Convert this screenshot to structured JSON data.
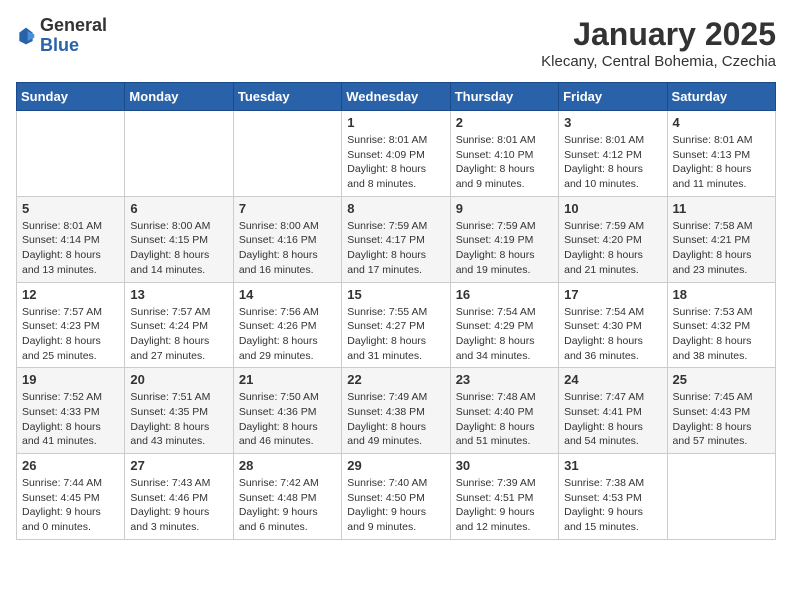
{
  "header": {
    "logo_general": "General",
    "logo_blue": "Blue",
    "month_title": "January 2025",
    "location": "Klecany, Central Bohemia, Czechia"
  },
  "weekdays": [
    "Sunday",
    "Monday",
    "Tuesday",
    "Wednesday",
    "Thursday",
    "Friday",
    "Saturday"
  ],
  "weeks": [
    [
      {
        "day": "",
        "content": ""
      },
      {
        "day": "",
        "content": ""
      },
      {
        "day": "",
        "content": ""
      },
      {
        "day": "1",
        "content": "Sunrise: 8:01 AM\nSunset: 4:09 PM\nDaylight: 8 hours and 8 minutes."
      },
      {
        "day": "2",
        "content": "Sunrise: 8:01 AM\nSunset: 4:10 PM\nDaylight: 8 hours and 9 minutes."
      },
      {
        "day": "3",
        "content": "Sunrise: 8:01 AM\nSunset: 4:12 PM\nDaylight: 8 hours and 10 minutes."
      },
      {
        "day": "4",
        "content": "Sunrise: 8:01 AM\nSunset: 4:13 PM\nDaylight: 8 hours and 11 minutes."
      }
    ],
    [
      {
        "day": "5",
        "content": "Sunrise: 8:01 AM\nSunset: 4:14 PM\nDaylight: 8 hours and 13 minutes."
      },
      {
        "day": "6",
        "content": "Sunrise: 8:00 AM\nSunset: 4:15 PM\nDaylight: 8 hours and 14 minutes."
      },
      {
        "day": "7",
        "content": "Sunrise: 8:00 AM\nSunset: 4:16 PM\nDaylight: 8 hours and 16 minutes."
      },
      {
        "day": "8",
        "content": "Sunrise: 7:59 AM\nSunset: 4:17 PM\nDaylight: 8 hours and 17 minutes."
      },
      {
        "day": "9",
        "content": "Sunrise: 7:59 AM\nSunset: 4:19 PM\nDaylight: 8 hours and 19 minutes."
      },
      {
        "day": "10",
        "content": "Sunrise: 7:59 AM\nSunset: 4:20 PM\nDaylight: 8 hours and 21 minutes."
      },
      {
        "day": "11",
        "content": "Sunrise: 7:58 AM\nSunset: 4:21 PM\nDaylight: 8 hours and 23 minutes."
      }
    ],
    [
      {
        "day": "12",
        "content": "Sunrise: 7:57 AM\nSunset: 4:23 PM\nDaylight: 8 hours and 25 minutes."
      },
      {
        "day": "13",
        "content": "Sunrise: 7:57 AM\nSunset: 4:24 PM\nDaylight: 8 hours and 27 minutes."
      },
      {
        "day": "14",
        "content": "Sunrise: 7:56 AM\nSunset: 4:26 PM\nDaylight: 8 hours and 29 minutes."
      },
      {
        "day": "15",
        "content": "Sunrise: 7:55 AM\nSunset: 4:27 PM\nDaylight: 8 hours and 31 minutes."
      },
      {
        "day": "16",
        "content": "Sunrise: 7:54 AM\nSunset: 4:29 PM\nDaylight: 8 hours and 34 minutes."
      },
      {
        "day": "17",
        "content": "Sunrise: 7:54 AM\nSunset: 4:30 PM\nDaylight: 8 hours and 36 minutes."
      },
      {
        "day": "18",
        "content": "Sunrise: 7:53 AM\nSunset: 4:32 PM\nDaylight: 8 hours and 38 minutes."
      }
    ],
    [
      {
        "day": "19",
        "content": "Sunrise: 7:52 AM\nSunset: 4:33 PM\nDaylight: 8 hours and 41 minutes."
      },
      {
        "day": "20",
        "content": "Sunrise: 7:51 AM\nSunset: 4:35 PM\nDaylight: 8 hours and 43 minutes."
      },
      {
        "day": "21",
        "content": "Sunrise: 7:50 AM\nSunset: 4:36 PM\nDaylight: 8 hours and 46 minutes."
      },
      {
        "day": "22",
        "content": "Sunrise: 7:49 AM\nSunset: 4:38 PM\nDaylight: 8 hours and 49 minutes."
      },
      {
        "day": "23",
        "content": "Sunrise: 7:48 AM\nSunset: 4:40 PM\nDaylight: 8 hours and 51 minutes."
      },
      {
        "day": "24",
        "content": "Sunrise: 7:47 AM\nSunset: 4:41 PM\nDaylight: 8 hours and 54 minutes."
      },
      {
        "day": "25",
        "content": "Sunrise: 7:45 AM\nSunset: 4:43 PM\nDaylight: 8 hours and 57 minutes."
      }
    ],
    [
      {
        "day": "26",
        "content": "Sunrise: 7:44 AM\nSunset: 4:45 PM\nDaylight: 9 hours and 0 minutes."
      },
      {
        "day": "27",
        "content": "Sunrise: 7:43 AM\nSunset: 4:46 PM\nDaylight: 9 hours and 3 minutes."
      },
      {
        "day": "28",
        "content": "Sunrise: 7:42 AM\nSunset: 4:48 PM\nDaylight: 9 hours and 6 minutes."
      },
      {
        "day": "29",
        "content": "Sunrise: 7:40 AM\nSunset: 4:50 PM\nDaylight: 9 hours and 9 minutes."
      },
      {
        "day": "30",
        "content": "Sunrise: 7:39 AM\nSunset: 4:51 PM\nDaylight: 9 hours and 12 minutes."
      },
      {
        "day": "31",
        "content": "Sunrise: 7:38 AM\nSunset: 4:53 PM\nDaylight: 9 hours and 15 minutes."
      },
      {
        "day": "",
        "content": ""
      }
    ]
  ]
}
